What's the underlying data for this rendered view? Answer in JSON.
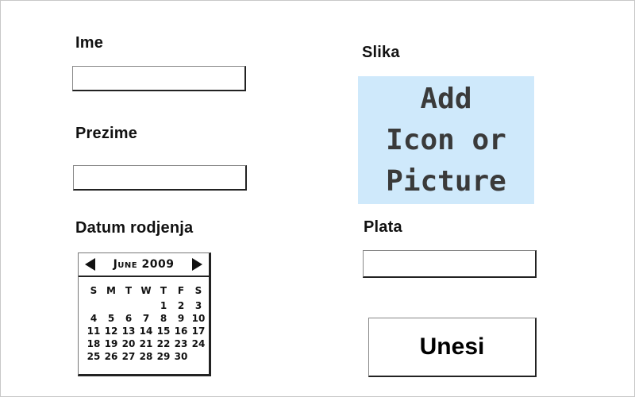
{
  "form": {
    "first_name": {
      "label": "Ime",
      "value": ""
    },
    "last_name": {
      "label": "Prezime",
      "value": ""
    },
    "birth_date": {
      "label": "Datum rodjenja"
    },
    "picture": {
      "label": "Slika",
      "placeholder_text": "Add\nIcon or\nPicture"
    },
    "salary": {
      "label": "Plata",
      "value": ""
    },
    "submit_label": "Unesi"
  },
  "calendar": {
    "month_label": "June 2009",
    "weekdays": [
      "S",
      "M",
      "T",
      "W",
      "T",
      "F",
      "S"
    ],
    "days": [
      "",
      "",
      "",
      "",
      "1",
      "2",
      "3",
      "4",
      "5",
      "6",
      "7",
      "8",
      "9",
      "10",
      "11",
      "12",
      "13",
      "14",
      "15",
      "16",
      "17",
      "18",
      "19",
      "20",
      "21",
      "22",
      "23",
      "24",
      "25",
      "26",
      "27",
      "28",
      "29",
      "30"
    ]
  },
  "colors": {
    "image_placeholder_bg": "#cfe9fb",
    "border_dark": "#222222"
  }
}
